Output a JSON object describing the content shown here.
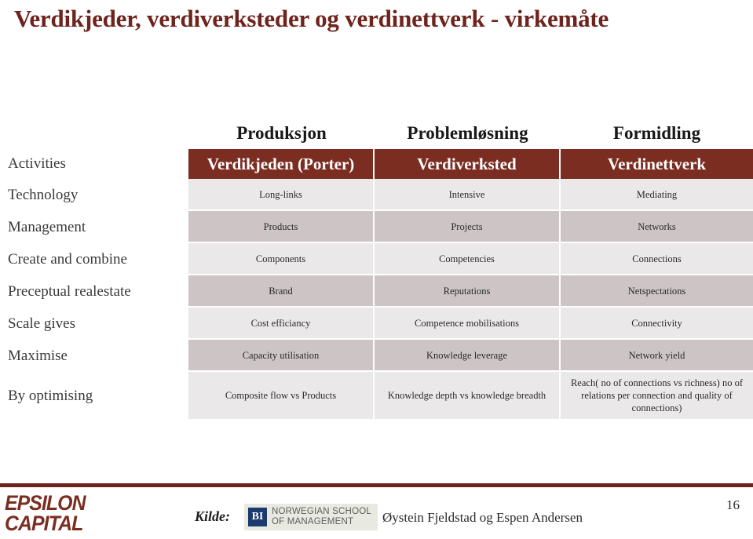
{
  "slide": {
    "title": "Verdikjeder, verdiverksteder og verdinettverk - virkemåte",
    "page_number": "16",
    "title_color": "#6E231C",
    "header_color": "#7B2D22",
    "band_light_color": "#eae8e8",
    "band_dark_color": "#cdc5c5"
  },
  "matrix": {
    "super_headers": [
      "",
      "Produksjon",
      "Problemløsning",
      "Formidling"
    ],
    "headers": [
      "Activities",
      "Verdikjeden (Porter)",
      "Verdiverksted",
      "Verdinettverk"
    ],
    "rows": [
      {
        "label": "Technology",
        "cells": [
          "Long-links",
          "Intensive",
          "Mediating"
        ]
      },
      {
        "label": "Management",
        "cells": [
          "Products",
          "Projects",
          "Networks"
        ]
      },
      {
        "label": "Create and combine",
        "cells": [
          "Components",
          "Competencies",
          "Connections"
        ]
      },
      {
        "label": "Preceptual realestate",
        "cells": [
          "Brand",
          "Reputations",
          "Netspectations"
        ]
      },
      {
        "label": "Scale gives",
        "cells": [
          "Cost efficiancy",
          "Competence mobilisations",
          "Connectivity"
        ]
      },
      {
        "label": "Maximise",
        "cells": [
          "Capacity utilisation",
          "Knowledge leverage",
          "Network yield"
        ]
      },
      {
        "label": "By optimising",
        "cells": [
          "Composite flow vs Products",
          "Knowledge depth vs knowledge breadth",
          "Reach( no of connections vs richness) no of relations per connection and quality of connections)"
        ]
      }
    ]
  },
  "footer": {
    "epsilon_line1": "EPSILON",
    "epsilon_line2": "CAPITAL",
    "kilde_label": "Kilde:",
    "bi_mark": "BI",
    "bi_line1": "NORWEGIAN SCHOOL",
    "bi_line2": "OF MANAGEMENT",
    "authors": "Øystein Fjeldstad og Espen Andersen"
  }
}
